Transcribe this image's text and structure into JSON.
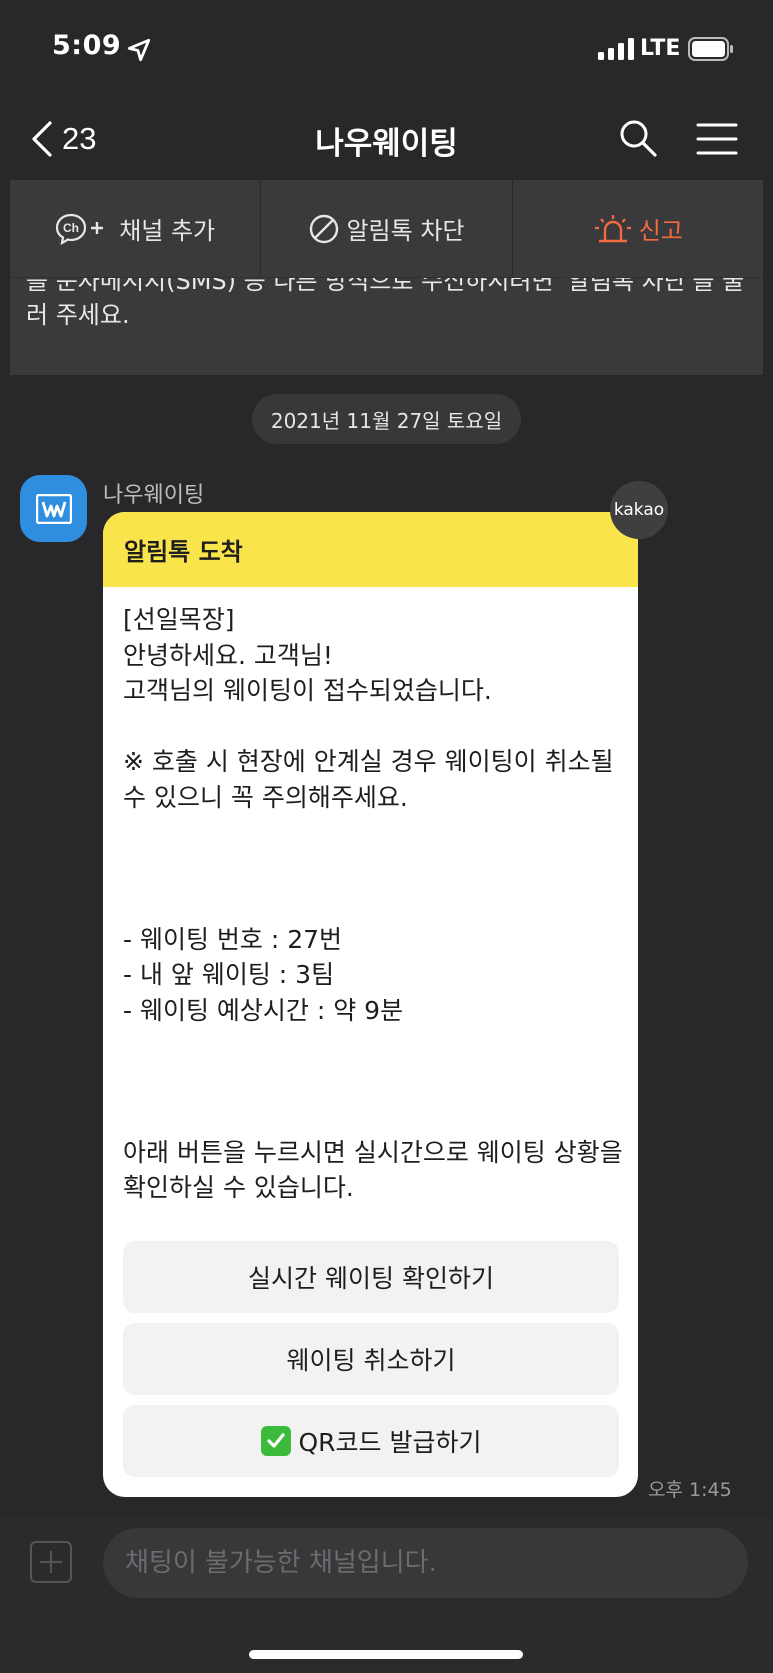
{
  "status_bar": {
    "time": "5:09",
    "network": "LTE"
  },
  "header": {
    "back_count": "23",
    "title": "나우웨이팅"
  },
  "actions": [
    {
      "label": "채널 추가",
      "icon": "channel-add-icon"
    },
    {
      "label": "알림톡 차단",
      "icon": "block-icon"
    },
    {
      "label": "신고",
      "icon": "siren-icon",
      "color": "#f26a3d"
    }
  ],
  "notice": {
    "text": "를 문자메시지(SMS) 등 다른 방식으로 수신하시려면 '알림톡 차단'을 눌러 주세요."
  },
  "date_divider": "2021년 11월 27일 토요일",
  "message": {
    "sender": "나우웨이팅",
    "badge": "kakao",
    "header": "알림톡 도착",
    "body": "[선일목장]\n안녕하세요. 고객님!\n고객님의 웨이팅이 접수되었습니다.\n\n※ 호출 시 현장에 안계실 경우 웨이팅이 취소될 수 있으니 꼭 주의해주세요.\n\n\n\n- 웨이팅 번호 : 27번\n- 내 앞 웨이팅 : 3팀\n- 웨이팅 예상시간 : 약 9분\n\n\n\n아래 버튼을 누르시면 실시간으로 웨이팅 상황을 확인하실 수 있습니다.",
    "buttons": [
      "실시간 웨이팅 확인하기",
      "웨이팅 취소하기",
      "QR코드 발급하기"
    ],
    "time": "오후 1:45"
  },
  "input": {
    "placeholder": "채팅이 불가능한 채널입니다."
  }
}
